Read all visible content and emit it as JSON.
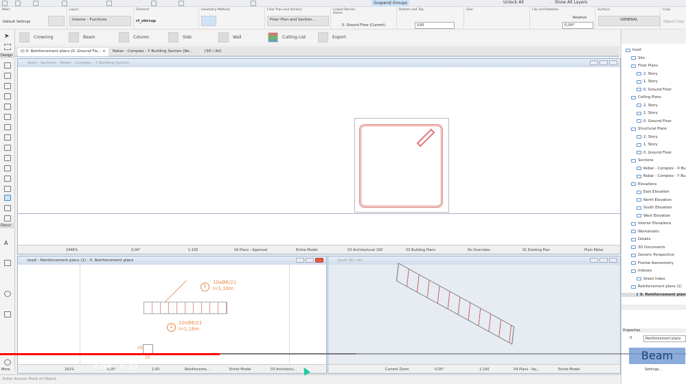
{
  "toolbar": {
    "suspend_groups": "Suspend Groups",
    "unlock_all": "Unlock All",
    "show_all_layers": "Show All Layers"
  },
  "infobox": {
    "main_label": "Main:",
    "main_value": "Default Settings",
    "layer_label": "Layer:",
    "layer_value": "Interior - Furniture",
    "element_label": "Element:",
    "element_value": "rf_stirrup",
    "geometry_label": "Geometry Method:",
    "floorplan_label": "Floor Plan and Section:",
    "floorplan_value": "Floor Plan and Section...",
    "stories_label": "Linked Stories:",
    "home_label": "Home:",
    "home_value": "0. Ground Floor (Current)",
    "bottomtop_label": "Bottom and Top:",
    "bottomtop_value": "100",
    "size_label": "Size:",
    "flip_label": "Flip and Rotation:",
    "relative": "Relative",
    "rotation": "0,00°",
    "surface_label": "Surface:",
    "surface_value": "GENERAL",
    "crop_label": "Crop:",
    "crop_value": "Object Crop"
  },
  "favorites": [
    "Crowning",
    "Beam",
    "Column",
    "Slab",
    "Wall",
    "Cutting List",
    "Export"
  ],
  "toolbox": {
    "design": "Design",
    "document": "Docur",
    "more": "More"
  },
  "tabs": [
    "(I) 0. Reinforcement plans [0. Ground Flo...",
    "Rebar - Complex - Y Building Section [Re...",
    "[3D / All]"
  ],
  "section_window": {
    "title": "teszt - Sections - Rebar - Complex - Y Building Section",
    "footer": [
      "2446%",
      "0,00°",
      "1:100",
      "04 Plans - Approval",
      "Entire Model",
      "03 Architectural 100",
      "03 Building Plans",
      "No Overrides",
      "01 Existing Plan",
      "Plain Meter"
    ]
  },
  "plan_window": {
    "title": "teszt - Reinforcement plans (1) - 0. Reinforcement plans",
    "label1": "10xØ6/21",
    "len1": "l=1,16m",
    "label2": "10xØ6/21",
    "len2": "l=1,16m",
    "marker": "1",
    "dim_v": "26",
    "dim_h": "26",
    "footer": [
      "162%",
      "0,00°",
      "1:50",
      "Reinforceme...",
      "Entire Model",
      "03 Architectu..."
    ]
  },
  "view3d_window": {
    "title": "teszt 3D / All",
    "footer": [
      "Current Zoom",
      "0,00°",
      "1:100",
      "04 Plans - Ap...",
      "Entire Model"
    ]
  },
  "navigator": {
    "items": [
      {
        "label": "teszt",
        "lvl": 0
      },
      {
        "label": "Site",
        "lvl": 1
      },
      {
        "label": "Floor Plans",
        "lvl": 1
      },
      {
        "label": "2. Story",
        "lvl": 2
      },
      {
        "label": "1. Story",
        "lvl": 2
      },
      {
        "label": "0. Ground Floor",
        "lvl": 2
      },
      {
        "label": "Ceiling Plans",
        "lvl": 1
      },
      {
        "label": "2. Story",
        "lvl": 2
      },
      {
        "label": "1. Story",
        "lvl": 2
      },
      {
        "label": "0. Ground Floor",
        "lvl": 2
      },
      {
        "label": "Structural Plans",
        "lvl": 1
      },
      {
        "label": "2. Story",
        "lvl": 2
      },
      {
        "label": "1. Story",
        "lvl": 2
      },
      {
        "label": "0. Ground Floor",
        "lvl": 2
      },
      {
        "label": "Sections",
        "lvl": 1
      },
      {
        "label": "Rebar - Complex - X Bu",
        "lvl": 2
      },
      {
        "label": "Rebar - Complex - Y Bu",
        "lvl": 2
      },
      {
        "label": "Elevations",
        "lvl": 1
      },
      {
        "label": "East Elevation",
        "lvl": 2
      },
      {
        "label": "North Elevation",
        "lvl": 2
      },
      {
        "label": "South Elevation",
        "lvl": 2
      },
      {
        "label": "West Elevation",
        "lvl": 2
      },
      {
        "label": "Interior Elevations",
        "lvl": 1
      },
      {
        "label": "Worksheets",
        "lvl": 1
      },
      {
        "label": "Details",
        "lvl": 1
      },
      {
        "label": "3D Documents",
        "lvl": 1
      },
      {
        "label": "Generic Perspective",
        "lvl": 1
      },
      {
        "label": "Frontal Axonometry",
        "lvl": 1
      },
      {
        "label": "Indexes",
        "lvl": 1
      },
      {
        "label": "Sheet Index",
        "lvl": 2
      },
      {
        "label": "Reinforcement plans (1)",
        "lvl": 1
      },
      {
        "label": "0. Reinforcement plans",
        "lvl": 2,
        "selected": true
      }
    ],
    "properties": "Properties",
    "prop_id": "0.",
    "prop_name": "Reinforcement plans",
    "settings": "Settings..."
  },
  "status": "Enter Anchor Point of Object.",
  "video": {
    "overlay_label": "Beam",
    "time": "2:04 / 6:33",
    "progress": 0.32,
    "buffered": 0.52,
    "progress_color": "#ff0000"
  }
}
